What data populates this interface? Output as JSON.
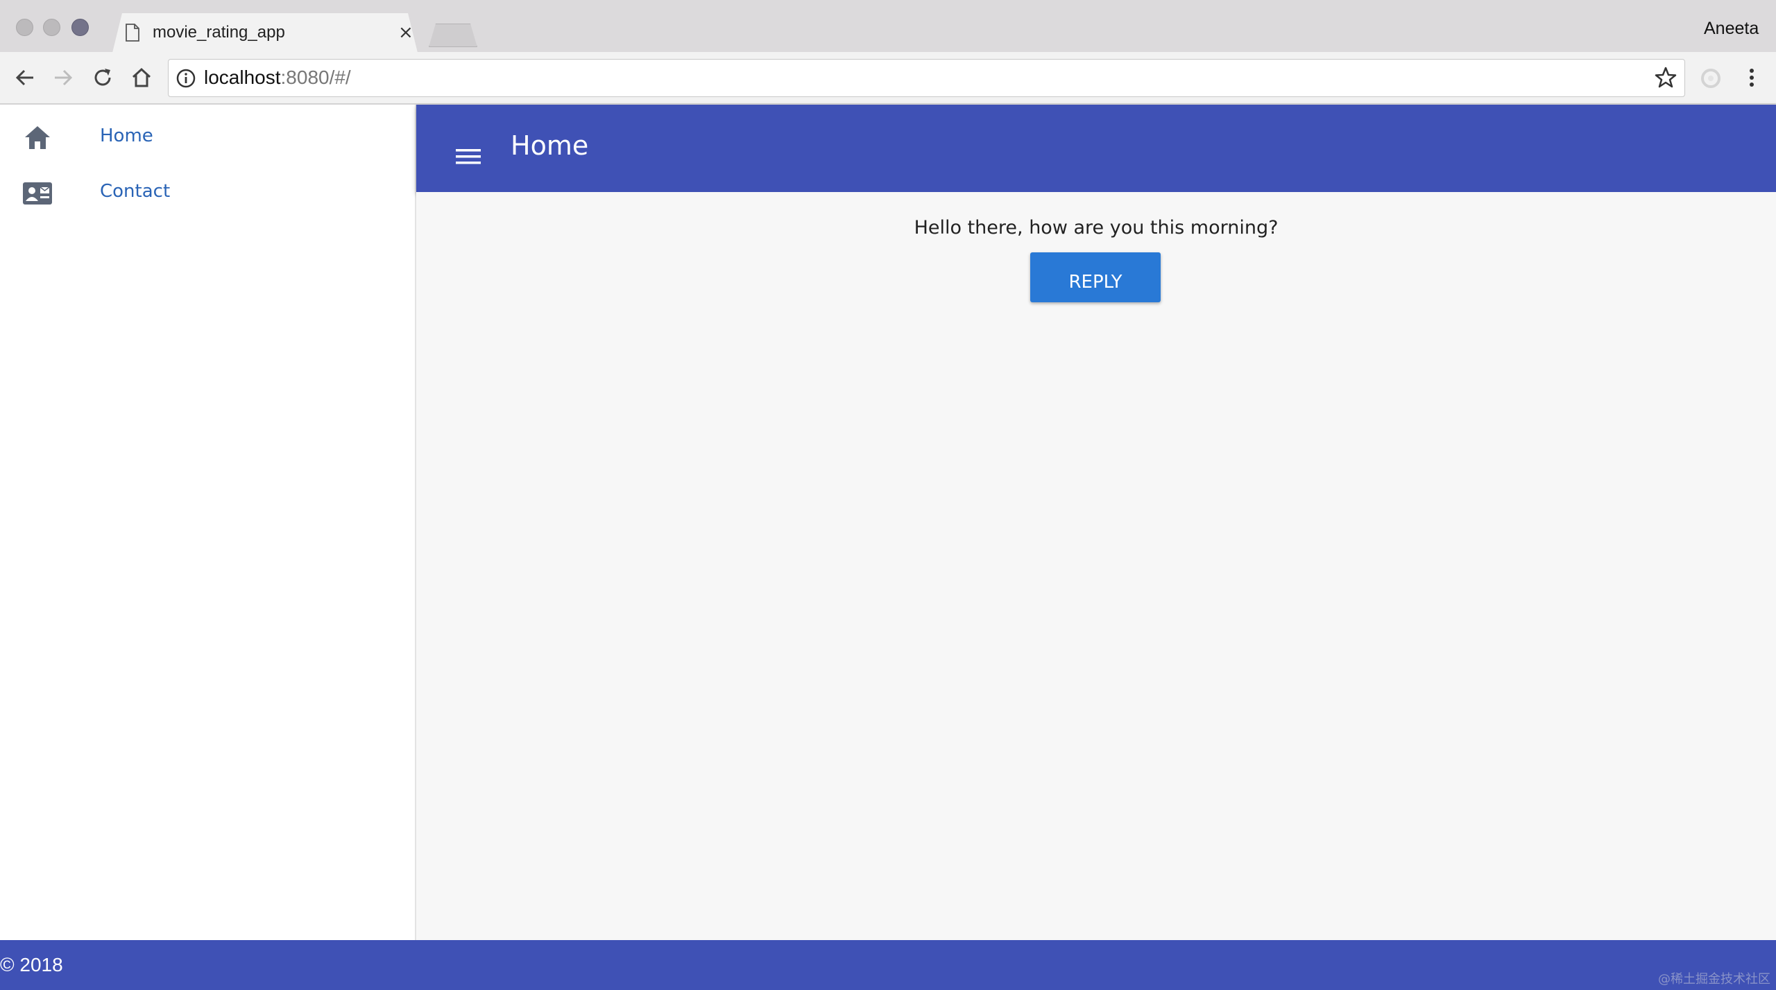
{
  "browser": {
    "tab_title": "movie_rating_app",
    "tab_close": "×",
    "profile_name": "Aneeta",
    "url_host": "localhost",
    "url_path": ":8080/#/"
  },
  "sidebar": {
    "items": [
      {
        "label": "Home",
        "icon": "home-icon"
      },
      {
        "label": "Contact",
        "icon": "contact-card-icon"
      }
    ]
  },
  "appbar": {
    "title": "Home",
    "menu_icon": "hamburger-menu-icon"
  },
  "main": {
    "greeting": "Hello there, how are you this morning?",
    "reply_label": "REPLY"
  },
  "footer": {
    "copyright": "© 2018"
  },
  "watermark": "@稀土掘金技术社区",
  "colors": {
    "primary": "#3f51b5",
    "button": "#2979d6",
    "link": "#2a64b6"
  }
}
